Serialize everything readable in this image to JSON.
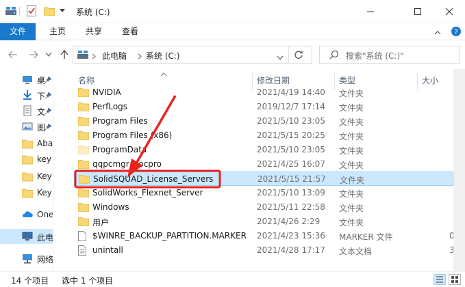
{
  "window": {
    "title": "系统 (C:)",
    "qa_icons": [
      "properties-icon",
      "new-folder-icon",
      "customize-quick-access-icon"
    ]
  },
  "ribbon": {
    "tabs": [
      "文件",
      "主页",
      "共享",
      "查看"
    ]
  },
  "address": {
    "segments": [
      "此电脑",
      "系统 (C:)"
    ]
  },
  "search": {
    "placeholder": "搜索\"系统 (C:)\""
  },
  "nav": {
    "items": [
      {
        "label": "桌",
        "icon": "desktop-icon",
        "pinned": true
      },
      {
        "label": "下",
        "icon": "downloads-icon",
        "pinned": true
      },
      {
        "label": "文",
        "icon": "documents-icon",
        "pinned": true
      },
      {
        "label": "图",
        "icon": "pictures-icon",
        "pinned": true
      },
      {
        "label": "Aba",
        "icon": "folder-icon",
        "pinned": false
      },
      {
        "label": "key",
        "icon": "folder-icon",
        "pinned": false
      },
      {
        "label": "Key",
        "icon": "folder-icon",
        "pinned": false
      },
      {
        "label": "Key",
        "icon": "folder-icon",
        "pinned": false
      },
      {
        "label": "OneD",
        "icon": "onedrive-icon",
        "pinned": false
      },
      {
        "label": "此电脑",
        "icon": "this-pc-icon",
        "pinned": false,
        "selected": true
      },
      {
        "label": "网络",
        "icon": "network-icon",
        "pinned": false
      }
    ]
  },
  "columns": {
    "name": "名称",
    "date": "修改日期",
    "type": "类型",
    "size": "大小"
  },
  "files": [
    {
      "name": "NVIDIA",
      "date": "2021/4/19 14:40",
      "type": "文件夹",
      "size": "",
      "icon": "folder"
    },
    {
      "name": "PerfLogs",
      "date": "2019/12/7 17:14",
      "type": "文件夹",
      "size": "",
      "icon": "folder"
    },
    {
      "name": "Program Files",
      "date": "2021/5/10 23:05",
      "type": "文件夹",
      "size": "",
      "icon": "folder"
    },
    {
      "name": "Program Files (x86)",
      "date": "2021/5/15 20:25",
      "type": "文件夹",
      "size": "",
      "icon": "folder"
    },
    {
      "name": "ProgramData",
      "date": "2021/5/10 23:05",
      "type": "文件夹",
      "size": "",
      "icon": "folder-hidden"
    },
    {
      "name": "qqpcmgr_docpro",
      "date": "2021/4/25 16:07",
      "type": "文件夹",
      "size": "",
      "icon": "folder"
    },
    {
      "name": "SolidSQUAD_License_Servers",
      "date": "2021/5/15 21:57",
      "type": "文件夹",
      "size": "",
      "icon": "folder",
      "selected": true
    },
    {
      "name": "SolidWorks_Flexnet_Server",
      "date": "2021/5/10 13:09",
      "type": "文件夹",
      "size": "",
      "icon": "folder"
    },
    {
      "name": "Windows",
      "date": "2021/5/11 22:58",
      "type": "文件夹",
      "size": "",
      "icon": "folder"
    },
    {
      "name": "用户",
      "date": "2021/4/26 2:29",
      "type": "文件夹",
      "size": "",
      "icon": "folder"
    },
    {
      "name": "$WINRE_BACKUP_PARTITION.MARKER",
      "date": "2021/4/23 15:36",
      "type": "MARKER 文件",
      "size": "0",
      "icon": "file"
    },
    {
      "name": "unintall",
      "date": "2021/4/28 17:17",
      "type": "文本文档",
      "size": "3",
      "icon": "text-file"
    }
  ],
  "status": {
    "count": "14 个项目",
    "selected": "选中 1 个项目"
  },
  "colors": {
    "accent": "#1979ca",
    "selection_bg": "#cce8ff",
    "selection_border": "#99d1ff",
    "annotation_red": "#e8231c",
    "folder_yellow": "#f8d775"
  }
}
